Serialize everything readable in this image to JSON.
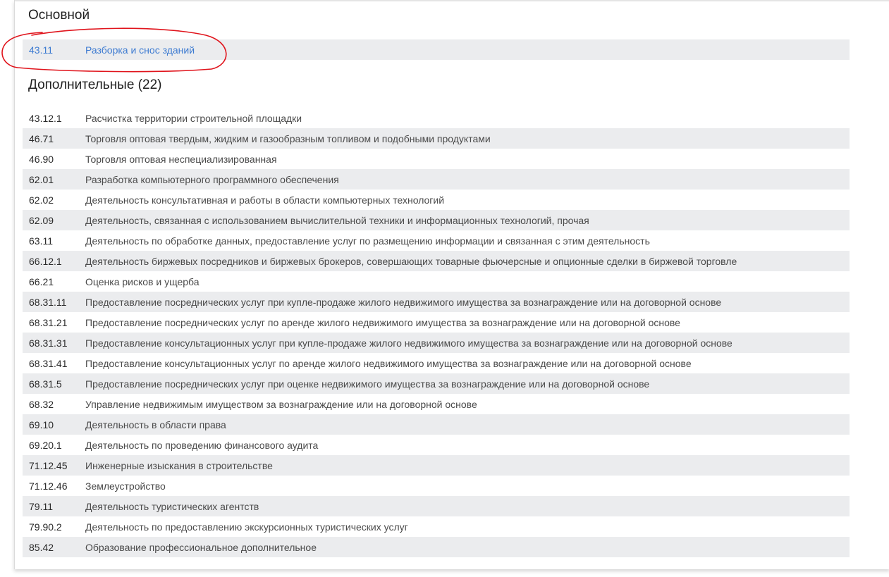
{
  "main_section": {
    "title": "Основной",
    "code": "43.11",
    "name": "Разборка и снос зданий"
  },
  "extra_section": {
    "title": "Дополнительные (22)",
    "items": [
      {
        "code": "43.12.1",
        "name": "Расчистка территории строительной площадки"
      },
      {
        "code": "46.71",
        "name": "Торговля оптовая твердым, жидким и газообразным топливом и подобными продуктами"
      },
      {
        "code": "46.90",
        "name": "Торговля оптовая неспециализированная"
      },
      {
        "code": "62.01",
        "name": "Разработка компьютерного программного обеспечения"
      },
      {
        "code": "62.02",
        "name": "Деятельность консультативная и работы в области компьютерных технологий"
      },
      {
        "code": "62.09",
        "name": "Деятельность, связанная с использованием вычислительной техники и информационных технологий, прочая"
      },
      {
        "code": "63.11",
        "name": "Деятельность по обработке данных, предоставление услуг по размещению информации и связанная с этим деятельность"
      },
      {
        "code": "66.12.1",
        "name": "Деятельность биржевых посредников и биржевых брокеров, совершающих товарные фьючерсные и опционные сделки в биржевой торговле"
      },
      {
        "code": "66.21",
        "name": "Оценка рисков и ущерба"
      },
      {
        "code": "68.31.11",
        "name": "Предоставление посреднических услуг при купле-продаже жилого недвижимого имущества за вознаграждение или на договорной основе"
      },
      {
        "code": "68.31.21",
        "name": "Предоставление посреднических услуг по аренде жилого недвижимого имущества за вознаграждение или на договорной основе"
      },
      {
        "code": "68.31.31",
        "name": "Предоставление консультационных услуг при купле-продаже жилого недвижимого имущества за вознаграждение или на договорной основе"
      },
      {
        "code": "68.31.41",
        "name": "Предоставление консультационных услуг по аренде жилого недвижимого имущества за вознаграждение или на договорной основе"
      },
      {
        "code": "68.31.5",
        "name": "Предоставление посреднических услуг при оценке недвижимого имущества за вознаграждение или на договорной основе"
      },
      {
        "code": "68.32",
        "name": "Управление недвижимым имуществом за вознаграждение или на договорной основе"
      },
      {
        "code": "69.10",
        "name": "Деятельность в области права"
      },
      {
        "code": "69.20.1",
        "name": "Деятельность по проведению финансового аудита"
      },
      {
        "code": "71.12.45",
        "name": "Инженерные изыскания в строительстве"
      },
      {
        "code": "71.12.46",
        "name": "Землеустройство"
      },
      {
        "code": "79.11",
        "name": "Деятельность туристических агентств"
      },
      {
        "code": "79.90.2",
        "name": "Деятельность по предоставлению экскурсионных туристических услуг"
      },
      {
        "code": "85.42",
        "name": "Образование профессиональное дополнительное"
      }
    ]
  },
  "colors": {
    "link": "#3d7bd1",
    "row_shade": "#ebecee",
    "annotation": "#e0141c"
  }
}
